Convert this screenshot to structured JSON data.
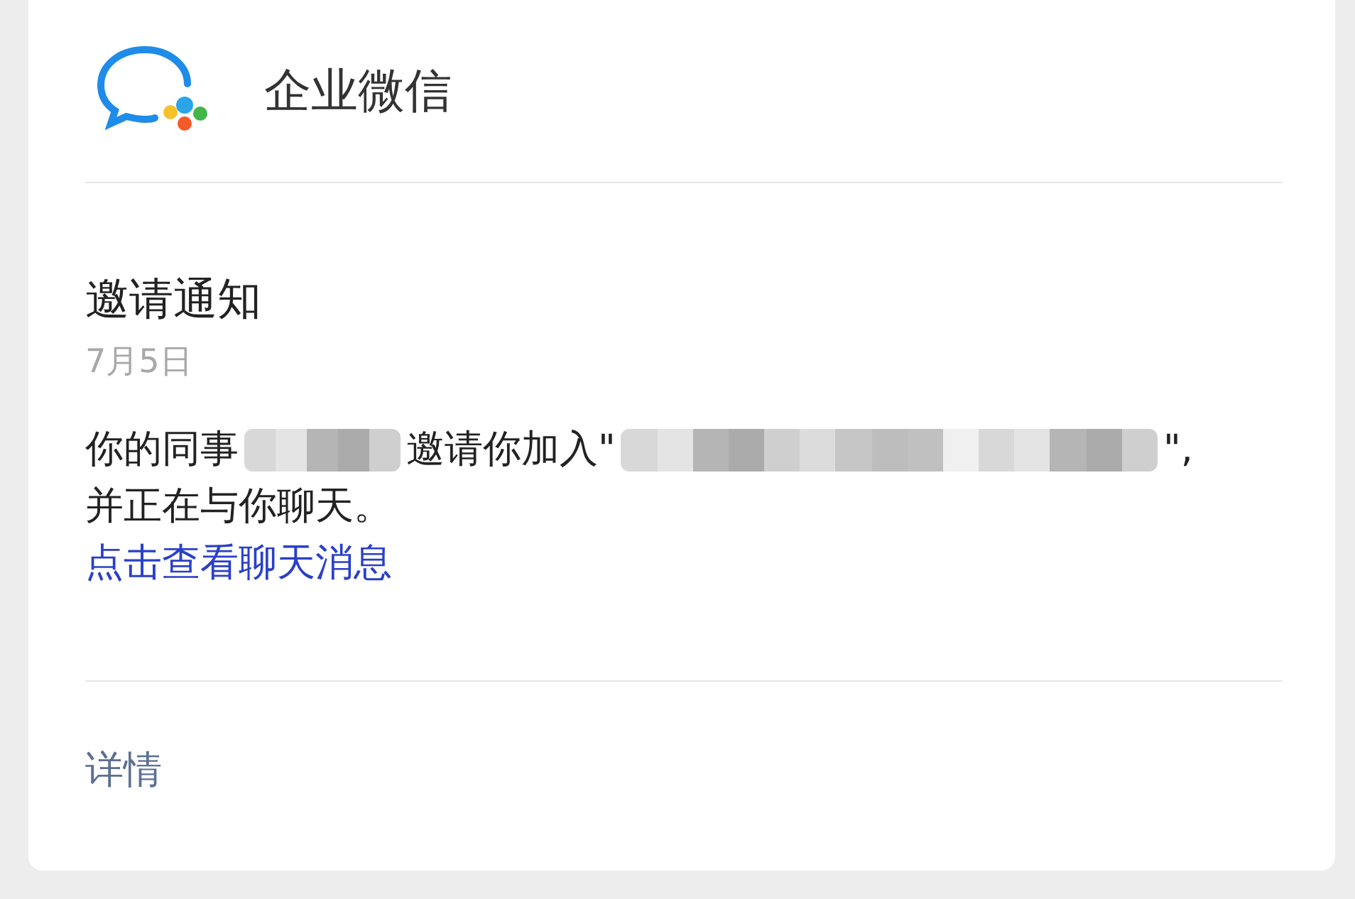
{
  "header": {
    "app_name": "企业微信"
  },
  "message": {
    "title": "邀请通知",
    "date": "7月5日",
    "lines": [
      [
        {
          "kind": "text",
          "text": "你的同事"
        },
        {
          "kind": "redacted"
        },
        {
          "kind": "text",
          "text": "邀请你加入\""
        },
        {
          "kind": "redacted"
        },
        {
          "kind": "text",
          "text": "\","
        }
      ],
      [
        {
          "kind": "text",
          "text": "并正在与你聊天。"
        }
      ]
    ],
    "link": "点击查看聊天消息"
  },
  "footer": {
    "details": "详情"
  }
}
